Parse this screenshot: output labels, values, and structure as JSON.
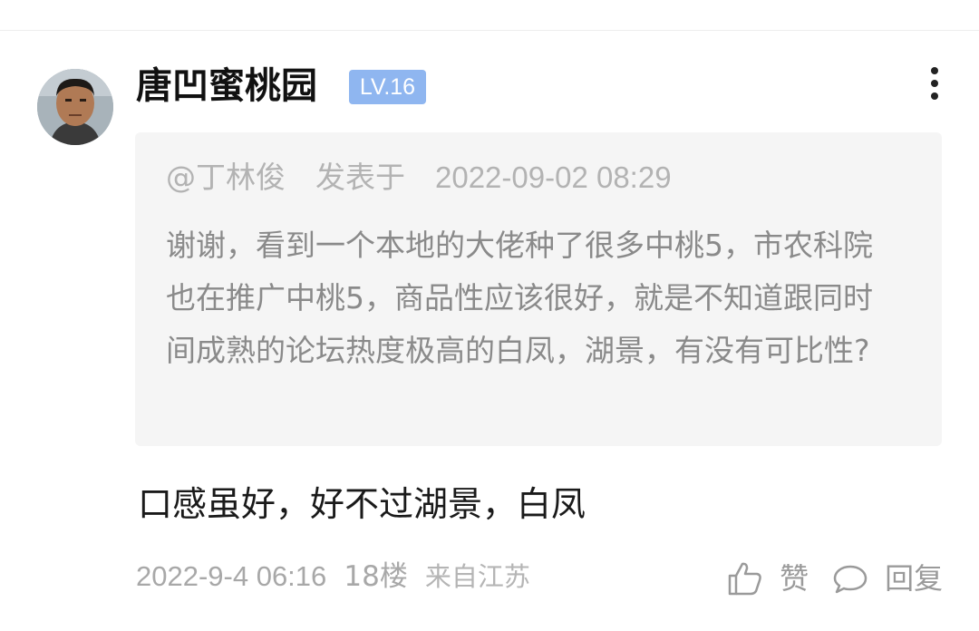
{
  "post": {
    "author": {
      "name": "唐凹蜜桃园",
      "level": "LV.16"
    },
    "quote": {
      "header_user": "@丁林俊",
      "header_prefix": "发表于",
      "header_time": "2022-09-02 08:29",
      "text": "谢谢，看到一个本地的大佬种了很多中桃5，市农科院也在推广中桃5，商品性应该很好，就是不知道跟同时间成熟的论坛热度极高的白凤，湖景，有没有可比性?"
    },
    "comment": "口感虽好，好不过湖景，白凤",
    "meta": {
      "date": "2022-9-4 06:16",
      "floor": "18楼",
      "location": "来自江苏"
    },
    "actions": {
      "like_label": "赞",
      "reply_label": "回复"
    }
  },
  "icons": {
    "more": "more-vertical-icon",
    "like": "thumbs-up-icon",
    "reply": "chat-bubble-icon"
  },
  "colors": {
    "level_badge": "#8fb6f0",
    "quote_background": "#f5f5f5",
    "meta_text": "#a8a8a8"
  }
}
